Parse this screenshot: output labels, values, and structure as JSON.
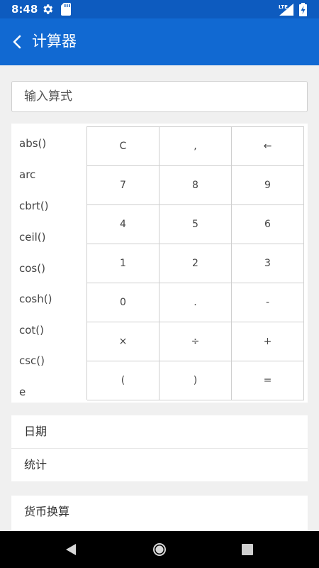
{
  "status_bar": {
    "time": "8:48",
    "network": "LTE",
    "icons": [
      "gear-icon",
      "sd-card-icon",
      "signal-icon",
      "battery-charging-icon"
    ]
  },
  "app_bar": {
    "title": "计算器",
    "back_icon": "chevron-left-icon"
  },
  "input": {
    "placeholder": "输入算式",
    "value": ""
  },
  "functions": [
    "abs()",
    "arc",
    "cbrt()",
    "ceil()",
    "cos()",
    "cosh()",
    "cot()",
    "csc()",
    "e"
  ],
  "keys": [
    [
      "C",
      ",",
      "←"
    ],
    [
      "7",
      "8",
      "9"
    ],
    [
      "4",
      "5",
      "6"
    ],
    [
      "1",
      "2",
      "3"
    ],
    [
      "0",
      ".",
      "-"
    ],
    [
      "×",
      "÷",
      "+"
    ],
    [
      "(",
      ")",
      "="
    ]
  ],
  "menu_group_1": [
    "日期",
    "统计"
  ],
  "menu_group_2": [
    "货币换算"
  ],
  "colors": {
    "status_bar": "#0d5bbf",
    "app_bar": "#1169d2",
    "background": "#f0f0f0",
    "nav_bar": "#000000"
  },
  "nav_bar": {
    "icons": [
      "nav-back-icon",
      "nav-home-icon",
      "nav-recents-icon"
    ]
  }
}
